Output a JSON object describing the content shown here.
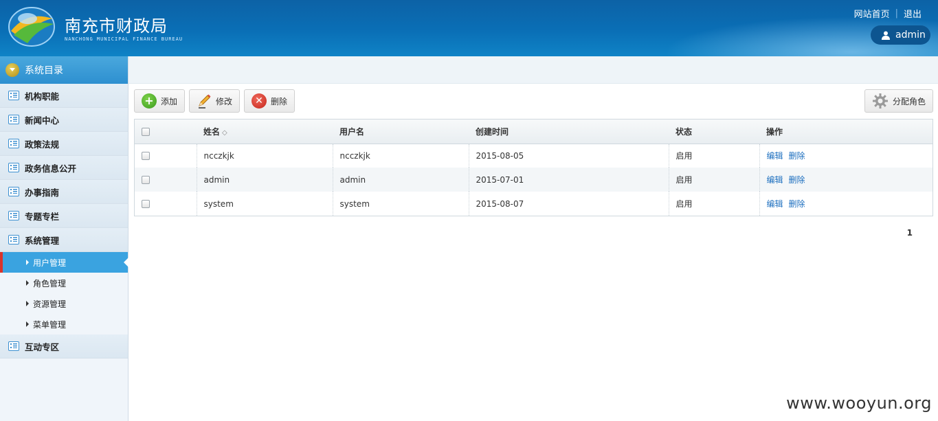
{
  "header": {
    "title": "南充市财政局",
    "subtitle": "NANCHONG MUNICIPAL FINANCE BUREAU",
    "links": {
      "home": "网站首页",
      "logout": "退出"
    },
    "user": "admin"
  },
  "sidebar": {
    "heading": "系统目录",
    "items": [
      {
        "label": "机构职能"
      },
      {
        "label": "新闻中心"
      },
      {
        "label": "政策法规"
      },
      {
        "label": "政务信息公开"
      },
      {
        "label": "办事指南"
      },
      {
        "label": "专题专栏"
      },
      {
        "label": "系统管理"
      }
    ],
    "sub_items": [
      {
        "label": "用户管理",
        "active": true
      },
      {
        "label": "角色管理"
      },
      {
        "label": "资源管理"
      },
      {
        "label": "菜单管理"
      }
    ],
    "last_item": {
      "label": "互动专区"
    }
  },
  "toolbar": {
    "add_label": "添加",
    "edit_label": "修改",
    "delete_label": "删除",
    "assign_role_label": "分配角色"
  },
  "table": {
    "columns": [
      "姓名",
      "用户名",
      "创建时间",
      "状态",
      "操作"
    ],
    "rows": [
      {
        "name": "ncczkjk",
        "username": "ncczkjk",
        "created": "2015-08-05",
        "status": "启用",
        "edit": "编辑",
        "delete": "删除"
      },
      {
        "name": "admin",
        "username": "admin",
        "created": "2015-07-01",
        "status": "启用",
        "edit": "编辑",
        "delete": "删除"
      },
      {
        "name": "system",
        "username": "system",
        "created": "2015-08-07",
        "status": "启用",
        "edit": "编辑",
        "delete": "删除"
      }
    ]
  },
  "pager": {
    "current": "1"
  },
  "watermark": "www.wooyun.org"
}
